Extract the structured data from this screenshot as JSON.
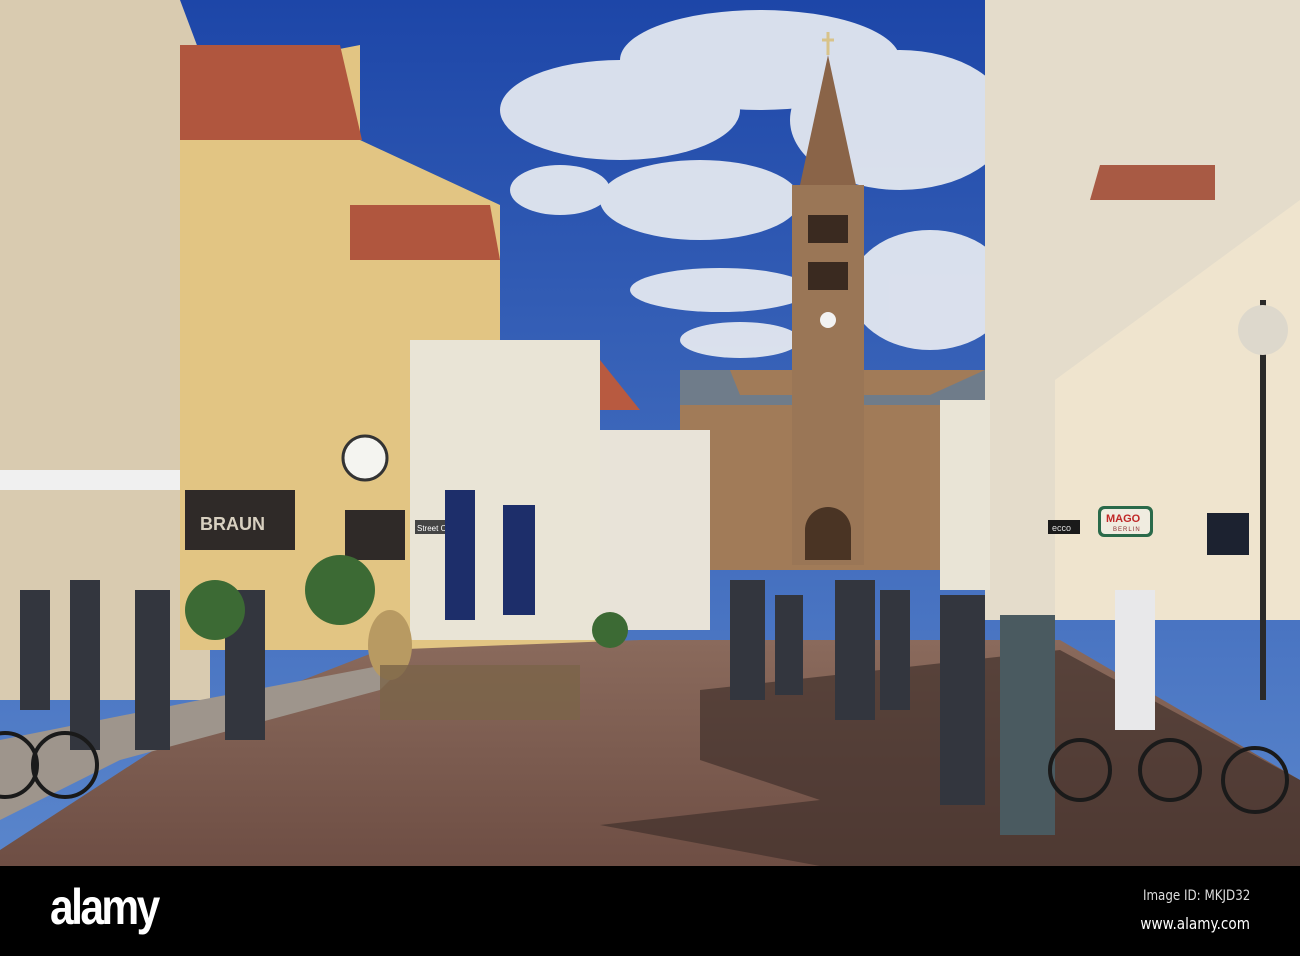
{
  "photo": {
    "subject": "Pedestrian street with church tower",
    "signs": {
      "tchibo": "BRAUN",
      "street_one": "Street One",
      "ecco": "ecco",
      "mago": "MAGO",
      "mago_sub": "BERLIN"
    }
  },
  "watermark": {
    "logo": "alamy",
    "image_id": "Image ID: MKJD32",
    "url": "www.alamy.com"
  },
  "colors": {
    "sky": "#2a5cb8",
    "pavement": "#7a5a4c",
    "bar": "#000000"
  }
}
